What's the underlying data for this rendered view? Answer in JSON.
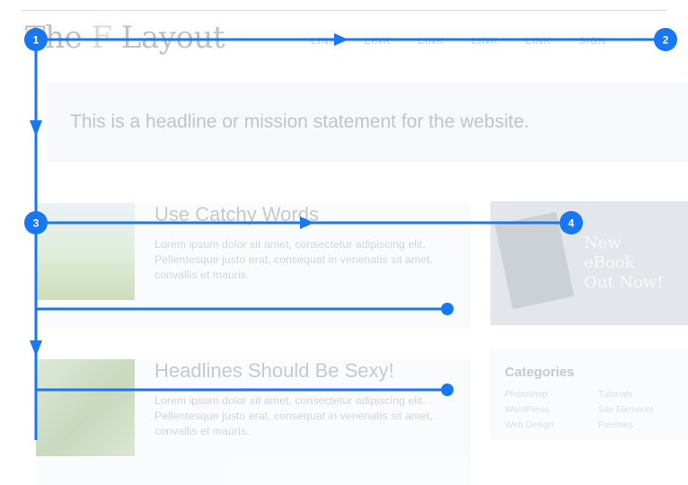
{
  "site": {
    "logo_prefix": "The ",
    "logo_f": "F",
    "logo_suffix": " Layout",
    "nav": [
      "LINK",
      "LINK",
      "LINK",
      "LINK",
      "LINK",
      "SIGN"
    ],
    "headline": "This is a headline or mission statement for the website."
  },
  "articles": [
    {
      "title": "Use Catchy Words",
      "body": "Lorem ipsum dolor sit amet, consectetur adipiscing elit. Pellentesque justo erat, consequat in venenatis sit amet, convallis et mauris."
    },
    {
      "title": "Headlines Should Be Sexy!",
      "body": "Lorem ipsum dolor sit amet, consectetur adipiscing elit. Pellentesque justo erat, consequat in venenatis sit amet, convallis et mauris."
    }
  ],
  "promo": {
    "text": "New\neBook\nOut Now!"
  },
  "categories": {
    "title": "Categories",
    "items": [
      "Photoshop",
      "Tutorials",
      "WordPress",
      "Site Elements",
      "Web Design",
      "Freebies"
    ]
  },
  "overlay": {
    "color": "#1877f2",
    "badges": [
      "1",
      "2",
      "3",
      "4"
    ]
  }
}
